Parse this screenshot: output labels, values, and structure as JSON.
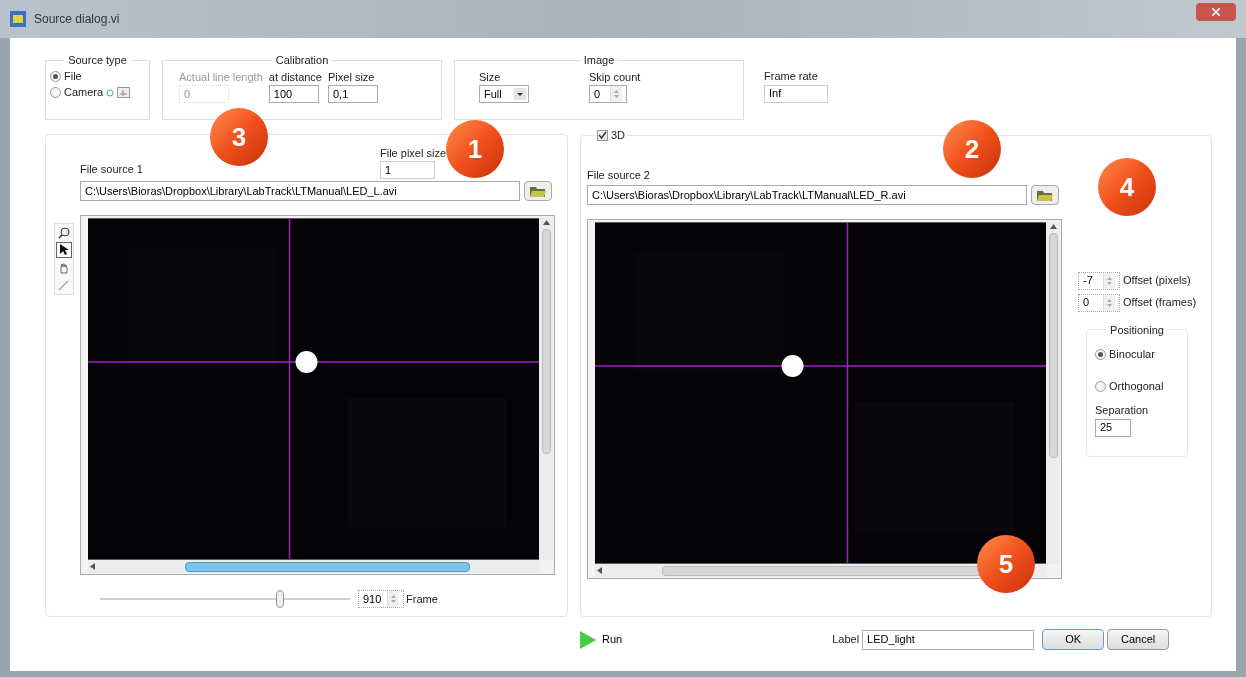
{
  "window": {
    "title": "Source dialog.vi"
  },
  "source_type": {
    "legend": "Source type",
    "options": [
      {
        "label": "File",
        "selected": true
      },
      {
        "label": "Camera",
        "selected": false
      }
    ]
  },
  "calibration": {
    "legend": "Calibration",
    "fields": [
      {
        "label": "Actual line length",
        "value": "0",
        "disabled": true
      },
      {
        "label": "at distance",
        "value": "100",
        "disabled": false
      },
      {
        "label": "Pixel size",
        "value": "0,1",
        "disabled": false
      }
    ]
  },
  "image": {
    "legend": "Image",
    "size": {
      "label": "Size",
      "value": "Full"
    },
    "skip_count": {
      "label": "Skip count",
      "value": "0"
    }
  },
  "frame_rate": {
    "label": "Frame rate",
    "value": "Inf"
  },
  "stereo_3d": {
    "label": "3D",
    "checked": true
  },
  "source1": {
    "pixel_size_label": "File pixel size",
    "pixel_size": "1",
    "label": "File source 1",
    "path": "C:\\Users\\Bioras\\Dropbox\\Library\\LabTrack\\LTManual\\LED_L.avi"
  },
  "tools": [
    {
      "kind": "zoom",
      "selected": false
    },
    {
      "kind": "pointer",
      "selected": true
    },
    {
      "kind": "pan",
      "selected": false
    },
    {
      "kind": "pen",
      "selected": false
    }
  ],
  "frame": {
    "level": 0.72,
    "value": "910",
    "label": "Frame"
  },
  "source2": {
    "label": "File source 2",
    "path": "C:\\Users\\Bioras\\Dropbox\\Library\\LabTrack\\LTManual\\LED_R.avi"
  },
  "offsets": [
    {
      "value": "-7",
      "label": "Offset (pixels)"
    },
    {
      "value": "0",
      "label": "Offset (frames)"
    }
  ],
  "positioning": {
    "legend": "Positioning",
    "options": [
      {
        "label": "Binocular",
        "selected": true
      },
      {
        "label": "Orthogonal",
        "selected": false
      }
    ],
    "separation_label": "Separation",
    "separation": "25"
  },
  "run": {
    "label": "Run"
  },
  "label_field": {
    "label": "Label",
    "value": "LED_light"
  },
  "buttons": [
    "OK",
    "Cancel"
  ],
  "callouts": [
    "1",
    "2",
    "3",
    "4",
    "5"
  ]
}
